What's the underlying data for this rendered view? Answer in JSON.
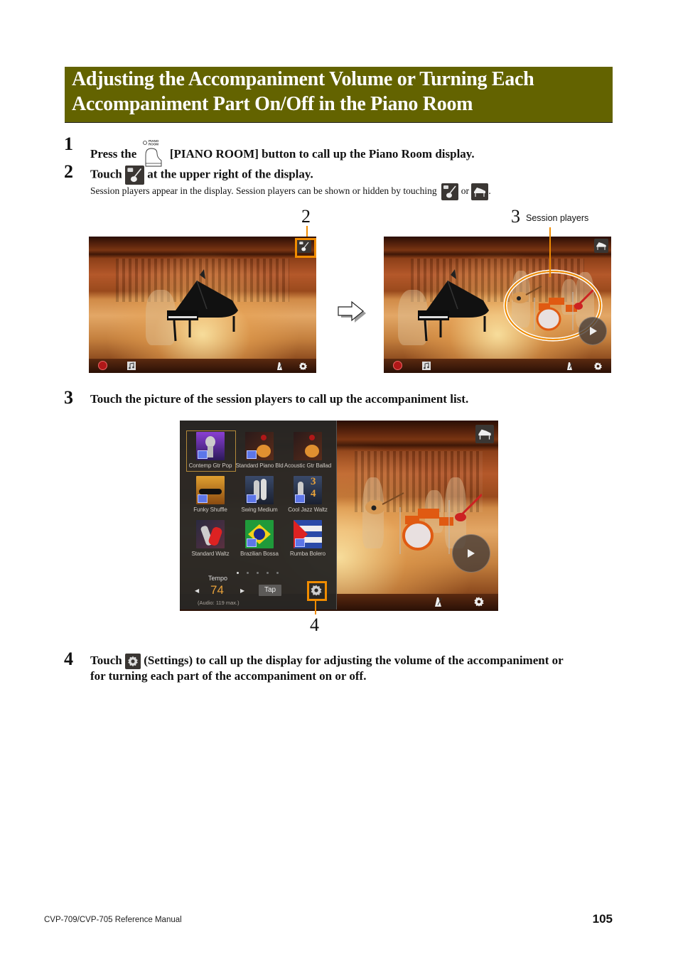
{
  "section": {
    "title_line1": "Adjusting the Accompaniment Volume or Turning Each",
    "title_line2": "Accompaniment Part On/Off in the Piano Room",
    "title_bg_color": "#636300"
  },
  "steps": [
    {
      "number": "1",
      "text_before": "Press the",
      "icon": "piano-room-button-icon",
      "icon_caption_line1": "PIANO",
      "icon_caption_line2": "ROOM",
      "text_after": "[PIANO ROOM] button to call up the Piano Room display."
    },
    {
      "number": "2",
      "text_before": "Touch",
      "icon": "session-players-icon",
      "text_after": "at the upper right of the display.",
      "sub_text_before": "Session players appear in the display. Session players can be shown or hidden by touching",
      "sub_icon_1": "session-players-icon",
      "sub_or": "or",
      "sub_icon_2": "grand-piano-icon",
      "sub_end": "."
    },
    {
      "number": "3",
      "text": "Touch the picture of the session players to call up the accompaniment list."
    },
    {
      "number": "4",
      "text_before": "Touch",
      "icon": "settings-gear-icon",
      "text_after_line1": "(Settings) to call up the display for adjusting the volume of the accompaniment or",
      "text_after_line2": "for turning each part of the accompaniment on or off."
    }
  ],
  "figure1": {
    "left_callout": "2",
    "right_callout_number": "3",
    "right_callout_label": "Session players",
    "arrow_icon": "right-arrow-icon",
    "screen_bottom_icons": [
      "record-icon",
      "music-note-icon",
      "metronome-icon",
      "settings-gear-icon"
    ]
  },
  "figure2": {
    "callout": "4",
    "styles": [
      {
        "label": "Contemp Gtr Pop",
        "selected": true,
        "audio": true
      },
      {
        "label": "Standard Piano Bld",
        "selected": false,
        "audio": true
      },
      {
        "label": "Acoustic Gtr Ballad",
        "selected": false,
        "audio": false
      },
      {
        "label": "Funky Shuffle",
        "selected": false,
        "audio": true
      },
      {
        "label": "Swing Medium",
        "selected": false,
        "audio": true
      },
      {
        "label": "Cool Jazz Waltz",
        "selected": false,
        "audio": true
      },
      {
        "label": "Standard Waltz",
        "selected": false,
        "audio": false
      },
      {
        "label": "Brazilian Bossa",
        "selected": false,
        "audio": true
      },
      {
        "label": "Rumba Bolero",
        "selected": false,
        "audio": true
      }
    ],
    "page_count": 5,
    "current_page": 1,
    "tempo_label": "Tempo",
    "tempo_value": "74",
    "tempo_note": "(Audio: 119 max.)",
    "tap_label": "Tap",
    "prev_arrow": "◀",
    "next_arrow": "▶",
    "highlight_color": "#f08c00"
  },
  "footer": {
    "manual": "CVP-709/CVP-705 Reference Manual",
    "page": "105"
  }
}
